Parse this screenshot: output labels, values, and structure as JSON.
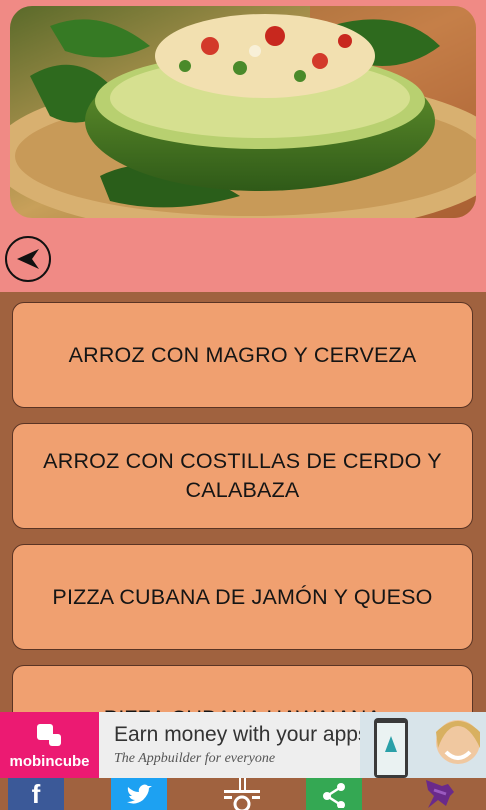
{
  "header": {
    "hero_image": "stuffed-avocado-photo",
    "back_icon": "back-arrow-icon"
  },
  "recipes": [
    {
      "label": "ARROZ CON MAGRO Y CERVEZA"
    },
    {
      "label": "ARROZ CON COSTILLAS DE CERDO Y CALABAZA"
    },
    {
      "label": "PIZZA CUBANA DE JAMÓN Y QUESO"
    },
    {
      "label": "PIZZA CUBANA HAWAIANA"
    }
  ],
  "ad": {
    "brand": "mobincube",
    "title": "Earn money with your apps",
    "subtitle": "The Appbuilder for everyone"
  },
  "social": {
    "facebook": {
      "icon": "facebook-icon",
      "label": "f",
      "color": "#3b5998"
    },
    "twitter": {
      "icon": "twitter-icon",
      "color": "#1da1f2"
    },
    "menu": {
      "icon": "food-menu-icon"
    },
    "share": {
      "icon": "share-icon",
      "color": "#34a853"
    },
    "pin": {
      "icon": "pin-icon",
      "color": "#6a2a8a"
    }
  },
  "colors": {
    "header_bg": "#f08a85",
    "list_bg": "#a0623f",
    "item_bg": "#f0a070",
    "ad_brand": "#ec1a72"
  }
}
